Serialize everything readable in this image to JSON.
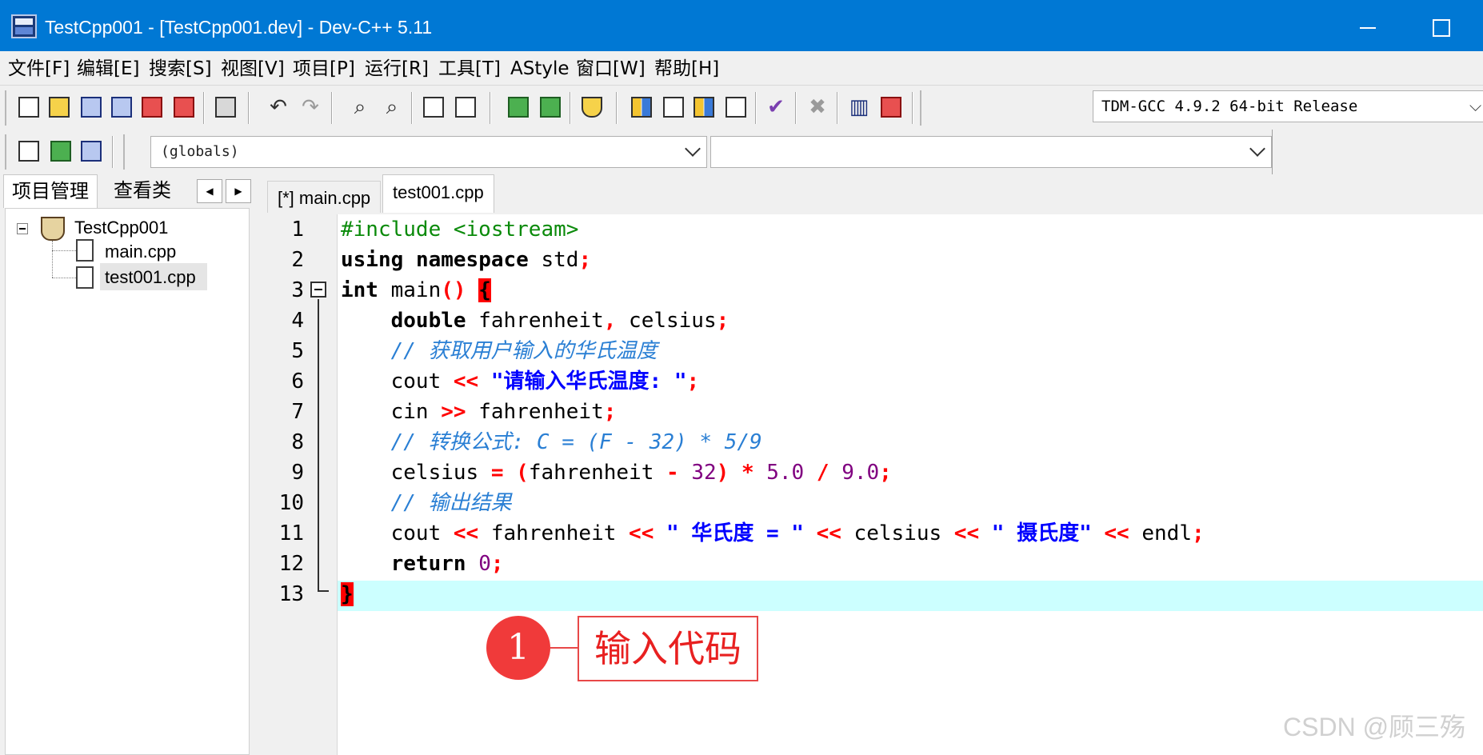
{
  "window": {
    "title": "TestCpp001 - [TestCpp001.dev] - Dev-C++ 5.11"
  },
  "menu": [
    "文件[F]",
    "编辑[E]",
    "搜索[S]",
    "视图[V]",
    "项目[P]",
    "运行[R]",
    "工具[T]",
    "AStyle",
    "窗口[W]",
    "帮助[H]"
  ],
  "toolbar": {
    "compiler": "TDM-GCC 4.9.2 64-bit Release"
  },
  "toolbar2": {
    "scope": "(globals)",
    "function": ""
  },
  "left_panel": {
    "tabs": [
      "项目管理",
      "查看类"
    ],
    "tree": {
      "project": "TestCpp001",
      "files": [
        "main.cpp",
        "test001.cpp"
      ]
    }
  },
  "editor": {
    "tabs": [
      "[*] main.cpp",
      "test001.cpp"
    ],
    "line_numbers": [
      "1",
      "2",
      "3",
      "4",
      "5",
      "6",
      "7",
      "8",
      "9",
      "10",
      "11",
      "12",
      "13"
    ]
  },
  "annotation": {
    "number": "1",
    "label": "输入代码"
  },
  "watermark": "CSDN @顾三殇",
  "colors": {
    "titlebar": "#0078d4",
    "current_line": "#ccffff",
    "comment": "#2a7fd4",
    "string": "#0000ff",
    "operator": "#ff0000",
    "preprocessor": "#0a8a0a",
    "annotation": "#e84848"
  }
}
